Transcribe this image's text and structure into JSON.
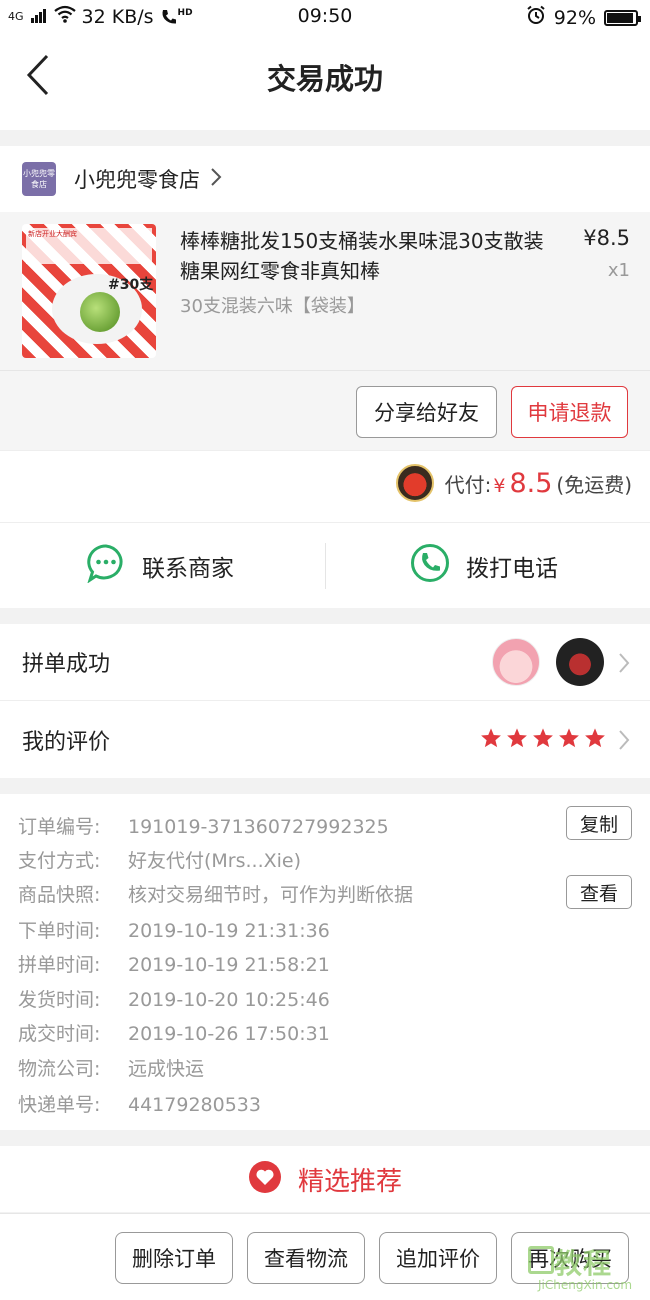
{
  "status_bar": {
    "network": "4G",
    "speed": "32 KB/s",
    "hd": "HD",
    "time": "09:50",
    "battery": "92%",
    "battery_level": 0.92
  },
  "nav": {
    "title": "交易成功",
    "back_icon": "chevron-left-icon"
  },
  "store": {
    "logo_text": "小兜兜零食店",
    "name": "小兜兜零食店"
  },
  "product": {
    "title": "棒棒糖批发150支桶装水果味混30支散装糖果网红零食非真知棒",
    "spec": "30支混装六味【袋装】",
    "price": "¥8.5",
    "qty": "x1",
    "image_badge": "#30支",
    "image_banner": "新店开业大酬宾"
  },
  "actions": {
    "share": "分享给好友",
    "refund": "申请退款"
  },
  "payment": {
    "label": "代付:",
    "currency": "¥",
    "amount": "8.5",
    "note": "(免运费)"
  },
  "contact": {
    "merchant": "联系商家",
    "call": "拨打电话"
  },
  "group": {
    "label": "拼单成功"
  },
  "review": {
    "label": "我的评价",
    "stars": 5
  },
  "order": {
    "lines": [
      {
        "key": "订单编号:",
        "value": "191019-371360727992325"
      },
      {
        "key": "支付方式:",
        "value": "好友代付(Mrs...Xie)"
      },
      {
        "key": "商品快照:",
        "value": "核对交易细节时，可作为判断依据"
      },
      {
        "key": "下单时间:",
        "value": "2019-10-19 21:31:36"
      },
      {
        "key": "拼单时间:",
        "value": "2019-10-19 21:58:21"
      },
      {
        "key": "发货时间:",
        "value": "2019-10-20 10:25:46"
      },
      {
        "key": "成交时间:",
        "value": "2019-10-26 17:50:31"
      },
      {
        "key": "物流公司:",
        "value": "远成快运"
      },
      {
        "key": "快递单号:",
        "value": "44179280533"
      }
    ],
    "copy": "复制",
    "view": "查看"
  },
  "recommend": {
    "title": "精选推荐"
  },
  "bottom": {
    "delete": "删除订单",
    "logistics": "查看物流",
    "add_review": "追加评价",
    "rebuy": "再次购买"
  },
  "watermark": {
    "top": "教程",
    "sub": "JiChengXin.com"
  },
  "colors": {
    "accent": "#e0393e",
    "green": "#2aae67",
    "muted": "#999999"
  }
}
